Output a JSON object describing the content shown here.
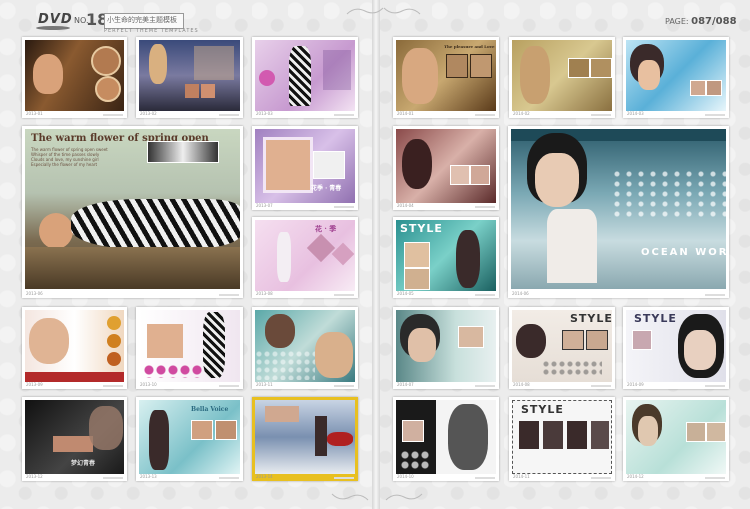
{
  "header": {
    "brand": "DVD",
    "issue_prefix": "NO.",
    "issue_number": "18",
    "series_title": "小生命的完美主题模板",
    "series_subtitle": "PERFECT THEME TEMPLATES",
    "page_label": "PAGE: ",
    "page_numbers": "087/088"
  },
  "left_page": {
    "feature_title": "The warm flower of spring open",
    "feature_body": "The warm flower of spring open sweet\nWhisper of the time passes slowly\nClouds and love, my sunshine girl\nEspecially the flower of my heart",
    "cards": [
      {
        "code": "2013-01"
      },
      {
        "code": "2013-02"
      },
      {
        "code": "2013-03"
      },
      {
        "code": "2013-06"
      },
      {
        "code": "2013-07"
      },
      {
        "code": "2013-08"
      },
      {
        "code": "2013-09"
      },
      {
        "code": "2013-10"
      },
      {
        "code": "2013-11"
      },
      {
        "code": "2013-12"
      },
      {
        "code": "2013-13"
      },
      {
        "code": "2013-14"
      }
    ],
    "overlays": {
      "spring_sig": "花季 · 青春",
      "flower": "花 · 季",
      "bella": "Bella Voice",
      "dream": "梦幻青春"
    }
  },
  "right_page": {
    "feature_title": "OCEAN WORLD",
    "style_word": "STYLE",
    "vintage_title": "The pleasure and Love",
    "cards": [
      {
        "code": "2014-01"
      },
      {
        "code": "2014-02"
      },
      {
        "code": "2014-03"
      },
      {
        "code": "2014-04"
      },
      {
        "code": "2014-05"
      },
      {
        "code": "2014-06"
      },
      {
        "code": "2014-07"
      },
      {
        "code": "2014-08"
      },
      {
        "code": "2014-09"
      },
      {
        "code": "2014-10"
      },
      {
        "code": "2014-11"
      },
      {
        "code": "2014-12"
      },
      {
        "code": "2014-13"
      }
    ]
  }
}
